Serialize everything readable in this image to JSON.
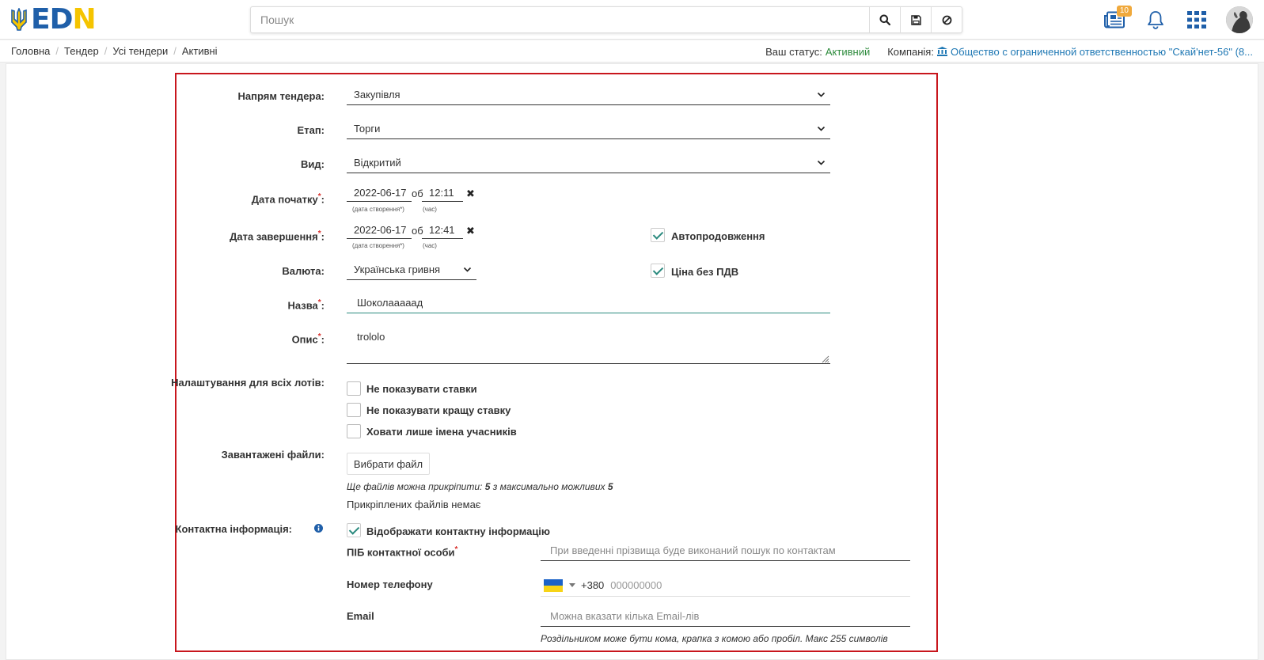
{
  "header": {
    "logo": {
      "e": "E",
      "d": "D",
      "n": "N"
    },
    "search": {
      "placeholder": "Пошук"
    },
    "news_badge": "10"
  },
  "breadcrumb": [
    "Головна",
    "Тендер",
    "Усі тендери",
    "Активні"
  ],
  "status": {
    "label": "Ваш статус:",
    "value": "Активний",
    "company_label": "Компанія:",
    "company_name": "Общество с ограниченной ответственностью \"Скай'нет-56\" (8..."
  },
  "form": {
    "direction": {
      "label": "Напрям тендера:",
      "value": "Закупівля"
    },
    "stage": {
      "label": "Етап:",
      "value": "Торги"
    },
    "type": {
      "label": "Вид:",
      "value": "Відкритий"
    },
    "start_date": {
      "label": "Дата початку",
      "date": "2022-06-17",
      "at": "об",
      "time": "12:11",
      "date_hint": "(дата створення*)",
      "time_hint": "(час)"
    },
    "end_date": {
      "label": "Дата завершення",
      "date": "2022-06-17",
      "at": "об",
      "time": "12:41",
      "date_hint": "(дата створення*)",
      "time_hint": "(час)"
    },
    "auto_extend": {
      "label": "Автопродовження",
      "checked": true
    },
    "currency": {
      "label": "Валюта:",
      "value": "Українська гривня"
    },
    "no_vat": {
      "label": "Ціна без ПДВ",
      "checked": true
    },
    "name": {
      "label": "Назва",
      "value": "Шоколааааад"
    },
    "description": {
      "label": "Опис",
      "value": "trololo"
    },
    "lot_settings": {
      "label": "Налаштування для всіх лотів:",
      "options": [
        {
          "label": "Не показувати ставки",
          "checked": false
        },
        {
          "label": "Не показувати кращу ставку",
          "checked": false
        },
        {
          "label": "Ховати лише імена учасників",
          "checked": false
        }
      ]
    },
    "files": {
      "label": "Завантажені файли:",
      "button": "Вибрати файл",
      "limit_prefix": "Ще файлів можна прикріпити:",
      "limit_count": "5",
      "limit_mid": "з максимально можливих",
      "limit_max": "5",
      "none_attached": "Прикріплених файлів немає"
    },
    "contact": {
      "label": "Контактна інформація:",
      "show_label": "Відображати контактну інформацію",
      "show_checked": true,
      "person_label": "ПІБ контактної особи",
      "person_placeholder": "При введенні прізвища буде виконаний пошук по контактам",
      "phone_label": "Номер телефону",
      "phone_code": "+380",
      "phone_placeholder": "000000000",
      "email_label": "Email",
      "email_placeholder": "Можна вказати кілька Email-лів",
      "email_note": "Роздільником може бути кома, крапка з комою або пробіл. Макс 255 символів"
    }
  },
  "colors": {
    "accent": "#2a8a7e",
    "frame": "#c8161d",
    "link": "#1f78b4",
    "active": "#2e8b3d",
    "badge": "#f0a93c"
  }
}
